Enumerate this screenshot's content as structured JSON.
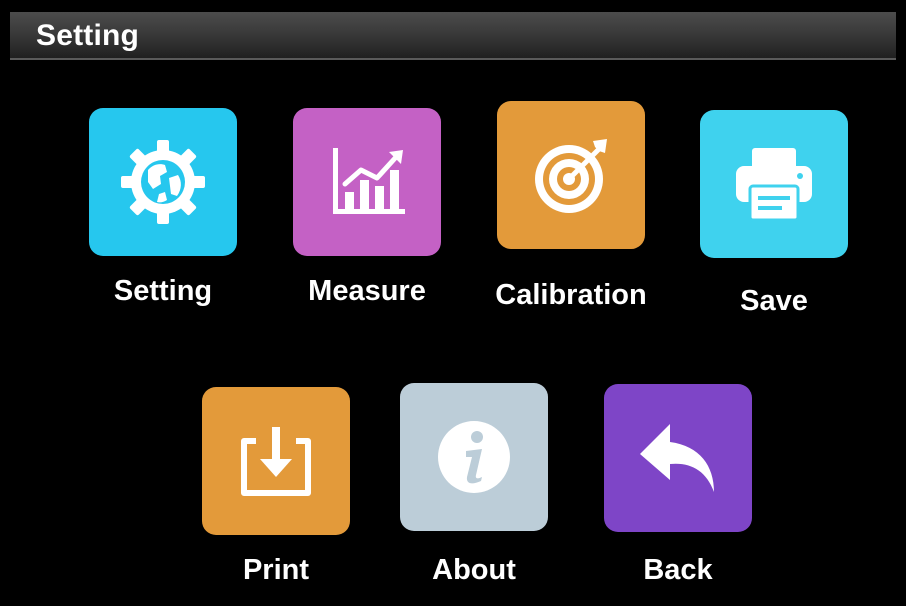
{
  "header": {
    "title": "Setting"
  },
  "menu": {
    "setting": {
      "label": "Setting",
      "icon": "gear-globe-icon",
      "color": "#26C7EE"
    },
    "measure": {
      "label": "Measure",
      "icon": "chart-icon",
      "color": "#C461C5"
    },
    "calibration": {
      "label": "Calibration",
      "icon": "target-icon",
      "color": "#E39A3A"
    },
    "save": {
      "label": "Save",
      "icon": "printer-icon",
      "color": "#3FD2EE"
    },
    "print": {
      "label": "Print",
      "icon": "download-icon",
      "color": "#E39A3A"
    },
    "about": {
      "label": "About",
      "icon": "info-icon",
      "color": "#BCCDD8"
    },
    "back": {
      "label": "Back",
      "icon": "back-arrow-icon",
      "color": "#7E45C7"
    }
  }
}
